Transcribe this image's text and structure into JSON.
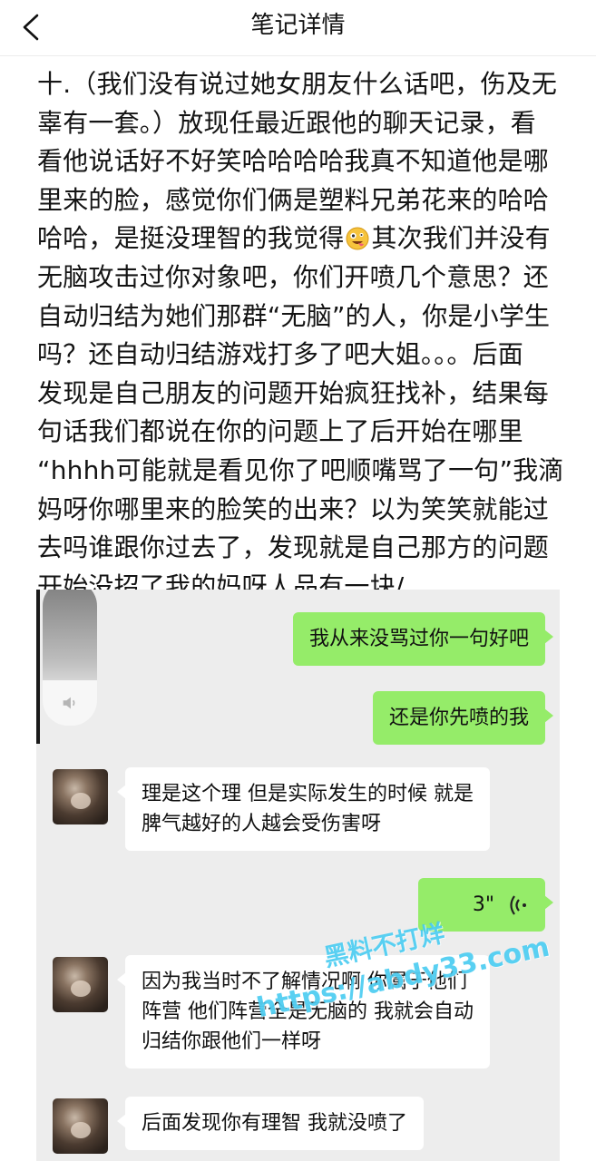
{
  "header": {
    "title": "笔记详情",
    "back_icon": "chevron-left-icon"
  },
  "note": {
    "lines": [
      "十.（我们没有说过她女朋友什么话吧，伤及无",
      "辜有一套。）放现任最近跟他的聊天记录，看",
      "看他说话好不好笑哈哈哈哈我真不知道他是哪",
      "里来的脸，感觉你们俩是塑料兄弟花来的哈哈",
      "哈哈，是挺没理智的我觉得",
      "其次我们并没有",
      "无脑攻击过你对象吧，你们开喷几个意思？还",
      "自动归结为她们那群“无脑”的人，你是小学生",
      "吗？还自动归结游戏打多了吧大姐。。。后面",
      "发现是自己朋友的问题开始疯狂找补，结果每",
      "句话我们都说在你的问题上了后开始在哪里",
      "“hhhh可能就是看见你了吧顺嘴骂了一句”我滴",
      "妈呀你哪里来的脸笑的出来？以为笑笑就能过",
      "去吗谁跟你过去了，发现就是自己那方的问题",
      "开始没招了我的妈呀人品有一块/."
    ],
    "emoji_icon": "zany-face-emoji-icon"
  },
  "chat": {
    "messages": [
      {
        "side": "me",
        "lines": [
          "我从来没骂过你一句好吧"
        ]
      },
      {
        "side": "me",
        "lines": [
          "还是你先喷的我"
        ]
      },
      {
        "side": "them",
        "lines": [
          "理是这个理 但是实际发生的时候 就是",
          "脾气越好的人越会受伤害呀"
        ]
      },
      {
        "side": "me",
        "type": "voice",
        "duration": "3\""
      },
      {
        "side": "them",
        "lines": [
          "因为我当时不了解情况啊 你属于他们",
          "阵营 他们阵营全是无脑的 我就会自动",
          "归结你跟他们一样呀"
        ]
      },
      {
        "side": "them",
        "lines": [
          "后面发现你有理智 我就没喷了"
        ]
      }
    ]
  },
  "watermark": {
    "line1": "黑料不打烊",
    "line2": "https://abdy33.com"
  },
  "colors": {
    "me_bubble": "#95ec69",
    "them_bubble": "#ffffff",
    "chat_bg": "#ededed",
    "watermark": "#3cc8f0"
  }
}
